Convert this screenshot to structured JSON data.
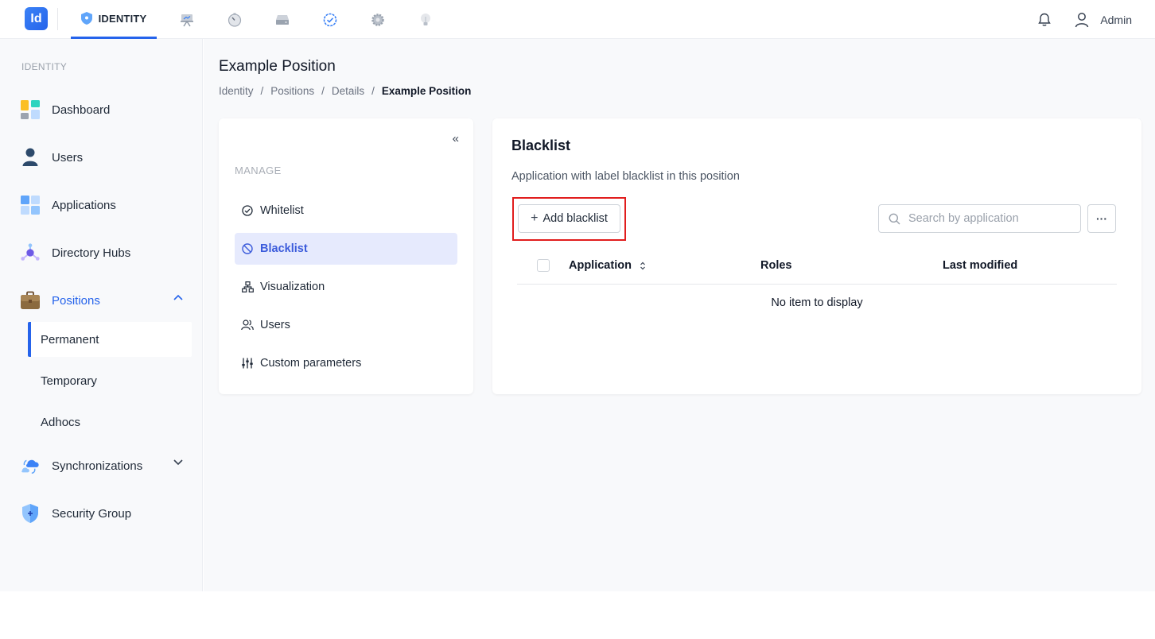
{
  "topbar": {
    "logo_text": "Id",
    "active_module": "IDENTITY",
    "modules": [
      {
        "name": "identity-module-tab",
        "label": "IDENTITY",
        "icon": "shield-icon"
      },
      {
        "name": "presentation-module-tab",
        "icon": "presentation-icon"
      },
      {
        "name": "timer-module-tab",
        "icon": "timer-icon"
      },
      {
        "name": "storage-module-tab",
        "icon": "drive-icon"
      },
      {
        "name": "check-module-tab",
        "icon": "check-circle-icon"
      },
      {
        "name": "settings-module-tab",
        "icon": "gear-icon"
      },
      {
        "name": "idea-module-tab",
        "icon": "lightbulb-icon"
      }
    ],
    "user_label": "Admin"
  },
  "sidebar": {
    "section_label": "IDENTITY",
    "items": [
      {
        "label": "Dashboard",
        "icon": "dashboard-icon"
      },
      {
        "label": "Users",
        "icon": "user-icon"
      },
      {
        "label": "Applications",
        "icon": "applications-icon"
      },
      {
        "label": "Directory Hubs",
        "icon": "hub-icon"
      },
      {
        "label": "Positions",
        "icon": "briefcase-icon",
        "expanded": true
      },
      {
        "label": "Synchronizations",
        "icon": "cloud-sync-icon",
        "expanded": false
      },
      {
        "label": "Security Group",
        "icon": "shield-icon"
      }
    ],
    "positions_sub": [
      {
        "label": "Permanent",
        "active": true
      },
      {
        "label": "Temporary"
      },
      {
        "label": "Adhocs"
      }
    ]
  },
  "page": {
    "title": "Example Position",
    "breadcrumb": [
      "Identity",
      "Positions",
      "Details",
      "Example Position"
    ]
  },
  "manage": {
    "collapse_glyph": "«",
    "section_label": "MANAGE",
    "items": [
      {
        "label": "Whitelist",
        "icon": "check-circle-icon"
      },
      {
        "label": "Blacklist",
        "icon": "block-icon",
        "active": true
      },
      {
        "label": "Visualization",
        "icon": "org-chart-icon"
      },
      {
        "label": "Users",
        "icon": "users-icon"
      },
      {
        "label": "Custom parameters",
        "icon": "sliders-icon"
      }
    ]
  },
  "blacklist": {
    "title": "Blacklist",
    "description": "Application with label blacklist in this position",
    "add_button": "Add blacklist",
    "search_placeholder": "Search by application",
    "more_glyph": "···",
    "columns": [
      "Application",
      "Roles",
      "Last modified"
    ],
    "empty_text": "No item to display"
  },
  "colors": {
    "accent": "#2563eb",
    "active_menu_bg": "#e6eafd",
    "highlight_border": "#e11d1d"
  }
}
